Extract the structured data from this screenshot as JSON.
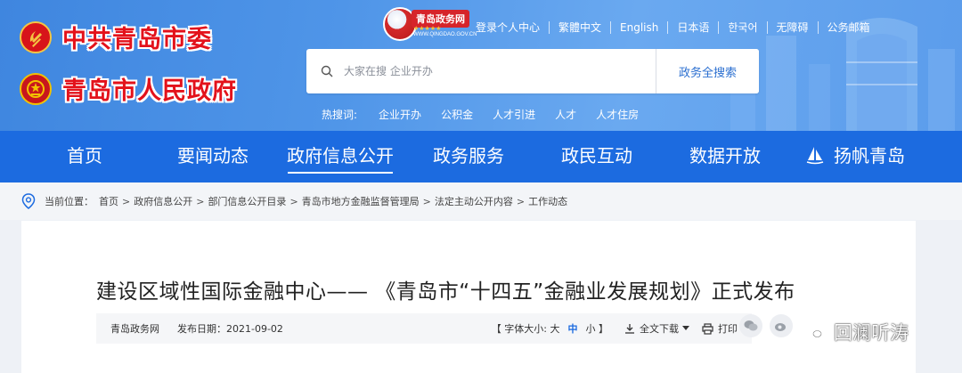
{
  "header": {
    "party_name": "中共青岛市委",
    "gov_name": "青岛市人民政府",
    "portal_logo_title": "青岛政务网",
    "portal_logo_sub": "WWW.QINGDAO.GOV.CN",
    "top_links": [
      {
        "label": "登录个人中心"
      },
      {
        "label": "繁體中文"
      },
      {
        "label": "English"
      },
      {
        "label": "日本语"
      },
      {
        "label": "한국어"
      },
      {
        "label": "无障碍"
      },
      {
        "label": "公务邮箱"
      }
    ],
    "search": {
      "placeholder": "大家在搜 企业开办",
      "button_label": "政务全搜索"
    },
    "hot": {
      "label": "热搜词:",
      "terms": [
        "企业开办",
        "公积金",
        "人才引进",
        "人才",
        "人才住房"
      ]
    }
  },
  "nav": {
    "items": [
      {
        "label": "首页"
      },
      {
        "label": "要闻动态"
      },
      {
        "label": "政府信息公开"
      },
      {
        "label": "政务服务"
      },
      {
        "label": "政民互动"
      },
      {
        "label": "数据开放"
      },
      {
        "label": "扬帆青岛"
      }
    ],
    "active_index": 2
  },
  "breadcrumb": {
    "label": "当前位置：",
    "items": [
      "首页",
      "政府信息公开",
      "部门信息公开目录",
      "青岛市地方金融监督管理局",
      "法定主动公开内容",
      "工作动态"
    ],
    "separator": ">"
  },
  "article": {
    "title": "建设区域性国际金融中心—— 《青岛市“十四五”金融业发展规划》正式发布",
    "source": "青岛政务网",
    "publish_date": "发布日期：2021-09-02",
    "font_size_label": "【 字体大小: 大",
    "font_medium": "中",
    "font_small": "小 】",
    "download_label": "全文下载",
    "print_label": "打印"
  },
  "watermark": {
    "text": "回澜听涛"
  },
  "colors": {
    "nav_blue": "#1c6be0",
    "header_blue": "#4f95e8",
    "brand_red": "#e3121b"
  }
}
